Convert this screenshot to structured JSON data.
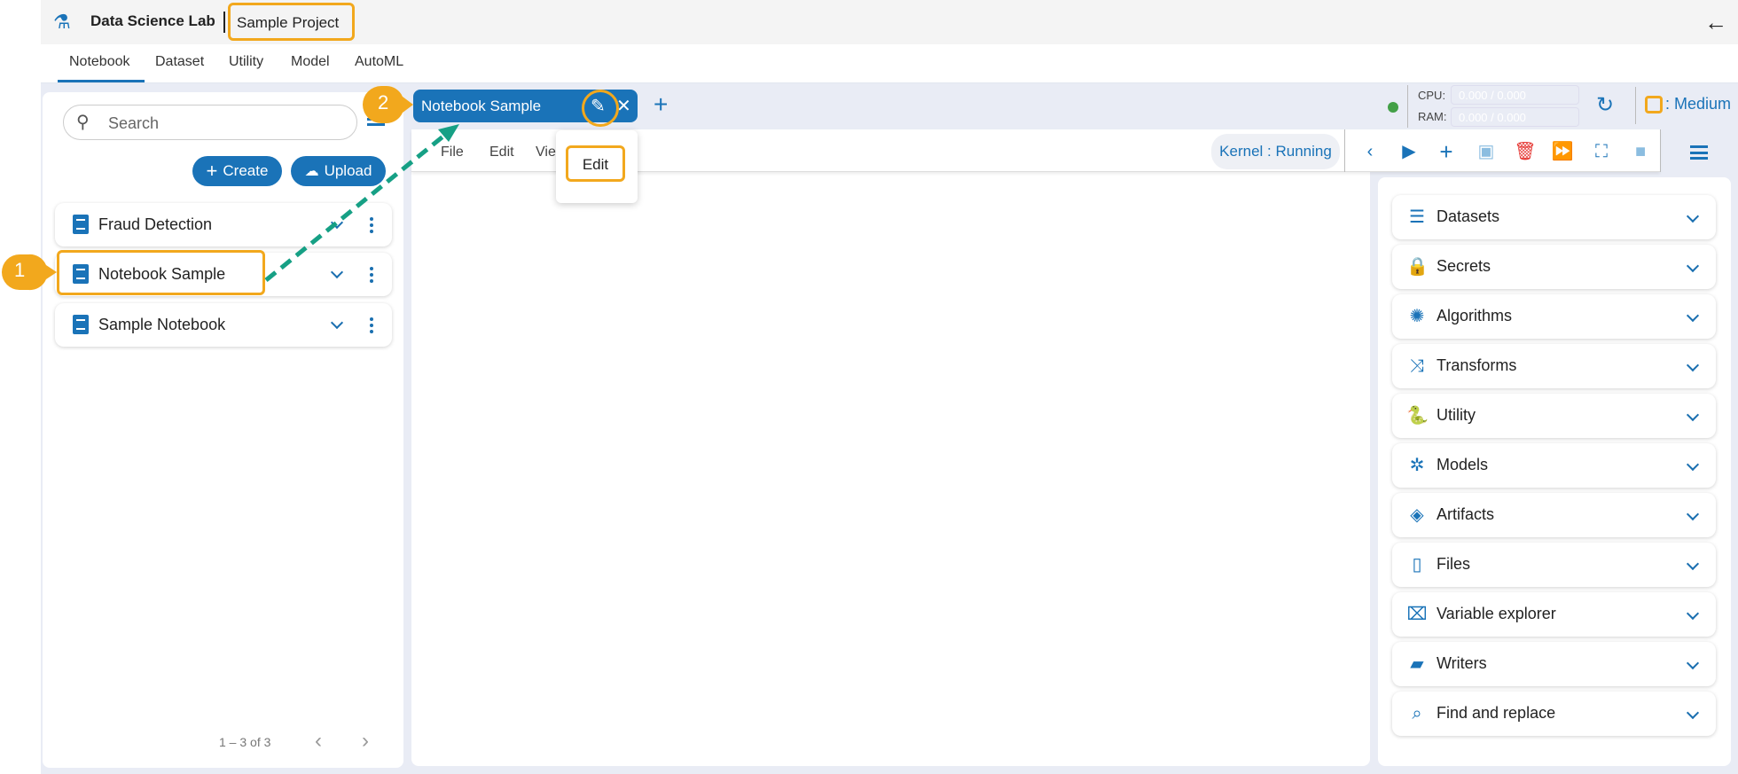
{
  "header": {
    "app_title": "Data Science Lab",
    "project": "Sample Project"
  },
  "nav": {
    "tabs": [
      "Notebook",
      "Dataset",
      "Utility",
      "Model",
      "AutoML"
    ]
  },
  "sidebar": {
    "search_placeholder": "Search",
    "create_label": "Create",
    "upload_label": "Upload",
    "items": [
      {
        "label": "Fraud Detection"
      },
      {
        "label": "Notebook Sample"
      },
      {
        "label": "Sample Notebook"
      }
    ],
    "pagination": "1 – 3 of 3"
  },
  "editor": {
    "tab_label": "Notebook Sample",
    "menu": [
      "File",
      "Edit",
      "Vie"
    ],
    "dropdown_item": "Edit",
    "kernel_status": "Kernel : Running",
    "cpu_label": "CPU:",
    "ram_label": "RAM:",
    "cpu_value": "0.000 / 0.000",
    "ram_value": "0.000 / 0.000",
    "instance_size": ": Medium"
  },
  "right_panel": {
    "sections": [
      {
        "label": "Datasets",
        "icon": "database-icon"
      },
      {
        "label": "Secrets",
        "icon": "lock-key-icon"
      },
      {
        "label": "Algorithms",
        "icon": "brain-icon"
      },
      {
        "label": "Transforms",
        "icon": "shuffle-icon"
      },
      {
        "label": "Utility",
        "icon": "python-icon"
      },
      {
        "label": "Models",
        "icon": "network-icon"
      },
      {
        "label": "Artifacts",
        "icon": "layers-icon"
      },
      {
        "label": "Files",
        "icon": "file-icon"
      },
      {
        "label": "Variable explorer",
        "icon": "variable-icon"
      },
      {
        "label": "Writers",
        "icon": "folder-icon"
      },
      {
        "label": "Find and replace",
        "icon": "find-replace-icon"
      }
    ]
  },
  "annotations": {
    "step1": "1",
    "step2": "2"
  },
  "colors": {
    "primary": "#1a73b8",
    "highlight": "#f2a81d",
    "arrow": "#16a085",
    "delete": "#e53935",
    "status_ok": "#43a047"
  }
}
